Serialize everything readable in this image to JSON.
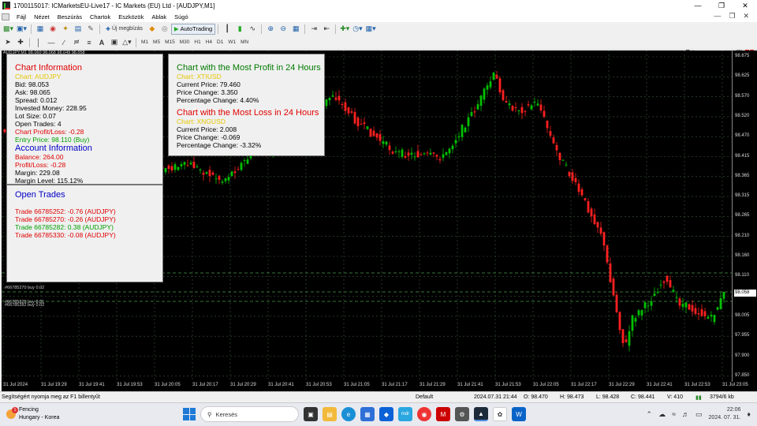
{
  "window": {
    "title": "1700115017: ICMarketsEU-Live17 - IC Markets (EU) Ltd - [AUDJPY,M1]"
  },
  "menu": {
    "items": [
      "Fájl",
      "Nézet",
      "Beszúrás",
      "Chartok",
      "Eszközök",
      "Ablak",
      "Súgó"
    ]
  },
  "toolbar": {
    "new_order": "Új megbízás",
    "autotrading": "AutoTrading"
  },
  "timeframes": [
    "M1",
    "M5",
    "M15",
    "M30",
    "H1",
    "H4",
    "D1",
    "W1",
    "MN"
  ],
  "chart": {
    "symbol_line": "AUDJPY,M1  98.060 98.068 98.049 98.058",
    "price_labels": [
      "98.675",
      "98.625",
      "98.570",
      "98.520",
      "98.470",
      "98.415",
      "98.365",
      "98.315",
      "98.265",
      "98.210",
      "98.160",
      "98.110",
      "98.055",
      "98.005",
      "97.955",
      "97.900",
      "97.850"
    ],
    "current_price": "98.058",
    "time_labels": [
      "31 Jul 2024",
      "31 Jul 19:29",
      "31 Jul 19:41",
      "31 Jul 19:53",
      "31 Jul 20:05",
      "31 Jul 20:17",
      "31 Jul 20:29",
      "31 Jul 20:41",
      "31 Jul 20:53",
      "31 Jul 21:05",
      "31 Jul 21:17",
      "31 Jul 21:29",
      "31 Jul 21:41",
      "31 Jul 21:53",
      "31 Jul 22:05",
      "31 Jul 22:17",
      "31 Jul 22:29",
      "31 Jul 22:41",
      "31 Jul 22:53",
      "31 Jul 23:05"
    ],
    "trade_labels": [
      "#66785270 buy 0.02",
      "#66785325 buy 0.01",
      "#66785282 buy 0.02"
    ],
    "colors": {
      "bull": "#00c000",
      "bear": "#ff2020",
      "grid": "#3a5a3a",
      "background": "#000000"
    }
  },
  "info_panel": {
    "title": "Chart Information",
    "chart": "Chart: AUDJPY",
    "bid": "Bid: 98.053",
    "ask": "Ask: 98.065",
    "spread": "Spread: 0.012",
    "invested": "Invested Money: 228.95",
    "lot": "Lot Size: 0.07",
    "open_trades": "Open Trades: 4",
    "chart_pl": "Chart Profit/Loss: -0.28",
    "entry": "Entry Price: 98.110 (Buy)",
    "account_title": "Account Information",
    "balance": "Balance: 264.00",
    "profit_loss": "Profit/Loss: -0.28",
    "margin": "Margin: 229.08",
    "margin_level": "Margin Level: 115.12%"
  },
  "trades_panel": {
    "title": "Open Trades",
    "trades": [
      {
        "text": "Trade 66785252: -0.76 (AUDJPY)",
        "color": "red"
      },
      {
        "text": "Trade 66785270: -0.26 (AUDJPY)",
        "color": "red"
      },
      {
        "text": "Trade 66785282: 0.38 (AUDJPY)",
        "color": "green"
      },
      {
        "text": "Trade 66785330: -0.08 (AUDJPY)",
        "color": "red"
      }
    ]
  },
  "profit_panel": {
    "profit_title": "Chart with the Most Profit in 24 Hours",
    "profit_chart": "Chart: XTIUSD",
    "profit_price": "Current Price: 79.460",
    "profit_change": "Price Change: 3.350",
    "profit_pct": "Percentage Change: 4.40%",
    "loss_title": "Chart with the Most Loss in 24 Hours",
    "loss_chart": "Chart: XNGUSD",
    "loss_price": "Current Price: 2.008",
    "loss_change": "Price Change: -0.069",
    "loss_pct": "Percentage Change: -3.32%"
  },
  "status": {
    "help": "Segítségért nyomja meg az F1 billentyűt",
    "profile": "Default",
    "datetime": "2024.07.31 21:44",
    "open": "O: 98.470",
    "high": "H: 98.473",
    "low": "L: 98.428",
    "close": "C: 98.441",
    "volume": "V: 410",
    "traffic": "3794/6 kb"
  },
  "taskbar": {
    "weather_title": "Fencing",
    "weather_sub": "Hungary - Korea",
    "weather_badge": "1",
    "search": "Keresés",
    "time": "22:06",
    "date": "2024. 07. 31.",
    "notif_badge": "1"
  }
}
